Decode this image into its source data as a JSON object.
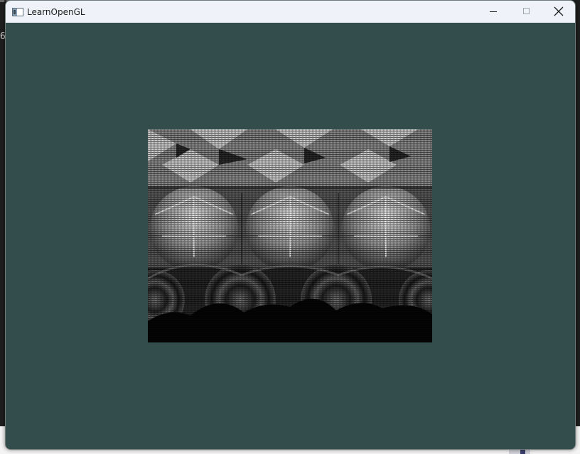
{
  "window": {
    "title": "LearnOpenGL",
    "icon": "app-window-icon",
    "controls": {
      "minimize": "minimize-icon",
      "maximize": "maximize-icon",
      "close": "close-icon"
    }
  },
  "viewport": {
    "clear_color": "#334d4d",
    "texture_style": "grayscale tiled texture with scanline artifacts"
  },
  "background": {
    "console_glyph": "6"
  },
  "colors": {
    "titlebar": "#eff3f9",
    "clear": "#334d4d"
  }
}
